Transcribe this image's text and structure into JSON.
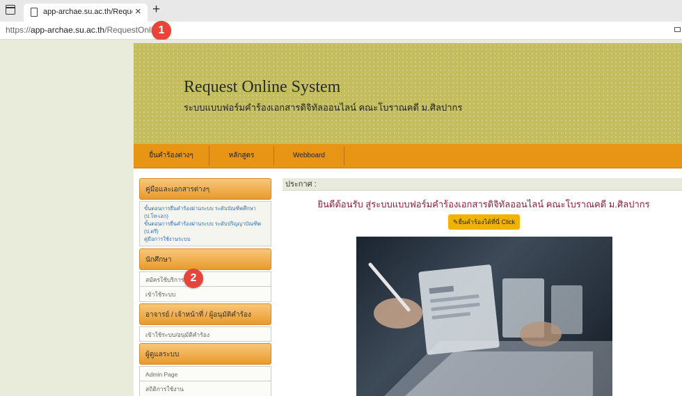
{
  "browser": {
    "tab_title": "app-archae.su.ac.th/RequestOnli",
    "url_prefix": "https://",
    "url_host": "app-archae.su.ac.th",
    "url_path": "/RequestOnline/",
    "close_glyph": "×",
    "newtab_glyph": "+"
  },
  "annotations": {
    "badge1": "1",
    "badge2": "2"
  },
  "banner": {
    "title": "Request Online System",
    "subtitle": "ระบบแบบฟอร์มคำร้องเอกสารดิจิทัลออนไลน์ คณะโบราณคดี ม.ศิลปากร"
  },
  "nav": {
    "items": [
      "ยื่นคำร้องต่างๆ",
      "หลักสูตร",
      "Webboard"
    ]
  },
  "sidebar": {
    "manuals_header": "คู่มือและเอกสารต่างๆ",
    "manual_links": [
      "ขั้นตอนการยื่นคำร้องผ่านระบบ ระดับบัณฑิตศึกษา (ป.โท-เอก)",
      "ขั้นตอนการยื่นคำร้องผ่านระบบ ระดับปริญญาบัณฑิต (ป.ตรี)",
      "คู่มือการใช้งานระบบ"
    ],
    "student_header": "นักศึกษา",
    "student_items": [
      "สมัครใช้บริการ",
      "เข้าใช้ระบบ"
    ],
    "staff_header": "อาจารย์ / เจ้าหน้าที่ / ผู้อนุมัติคำร้อง",
    "staff_items": [
      "เข้าใช้ระบบ/อนุมัติคำร้อง"
    ],
    "admin_header": "ผู้ดูแลระบบ",
    "admin_items": [
      "Admin Page",
      "สถิติการใช้งาน"
    ]
  },
  "main": {
    "announce_label": "ประกาศ :",
    "welcome": "ยินดีต้อนรับ สู่ระบบแบบฟอร์มคำร้องเอกสารดิจิทัลออนไลน์ คณะโบราณคดี ม.ศิลปากร",
    "cta_label": "✎ยื่นคำร้องได้ที่นี่ Click"
  },
  "colors": {
    "banner": "#c3bd5e",
    "nav": "#e89414",
    "sidebar_header": "#f2a93b",
    "welcome_text": "#8b1b3a",
    "cta": "#f2b300",
    "badge": "#e8443a"
  }
}
